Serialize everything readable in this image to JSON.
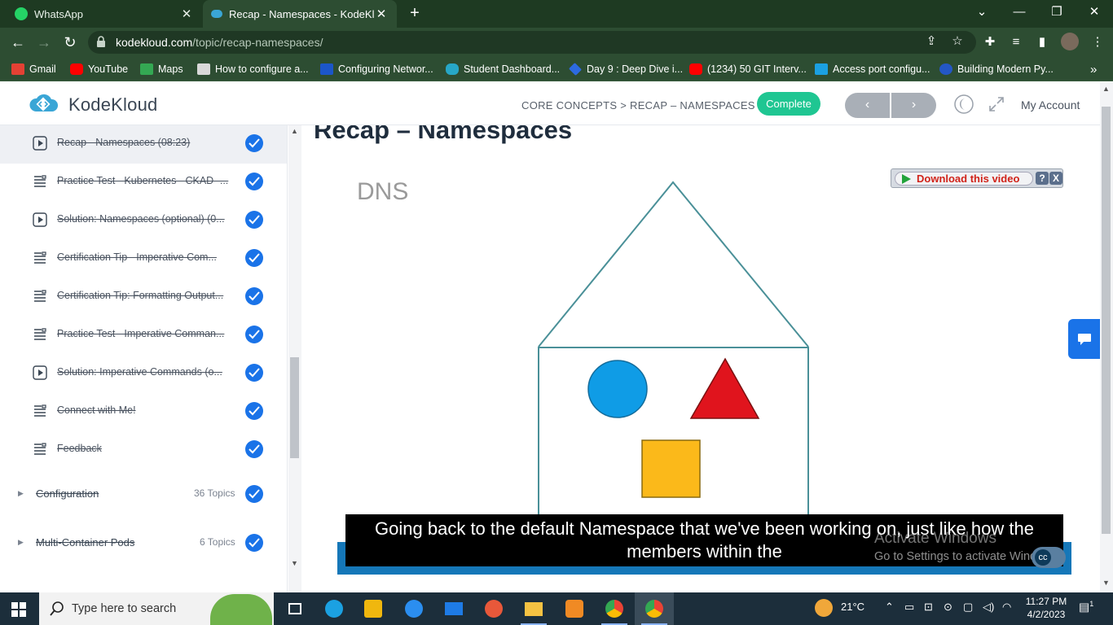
{
  "browser": {
    "tabs": [
      {
        "label": "WhatsApp",
        "close": "✕"
      },
      {
        "label": "Recap - Namespaces - KodeKloud",
        "close": "✕"
      }
    ],
    "new_tab": "+",
    "window_controls": [
      "⌄",
      "—",
      "❐",
      "✕"
    ],
    "url_domain": "kodekloud.com",
    "url_path": "/topic/recap-namespaces/",
    "bookmarks": [
      {
        "label": "Gmail",
        "color": "#e44134"
      },
      {
        "label": "YouTube",
        "color": "#ff0000"
      },
      {
        "label": "Maps",
        "color": "#34a853"
      },
      {
        "label": "How to configure a...",
        "color": "#d9d9d9"
      },
      {
        "label": "Configuring Networ...",
        "color": "#1c56c9"
      },
      {
        "label": "Student Dashboard...",
        "color": "#27a7c7"
      },
      {
        "label": "Day 9 : Deep Dive i...",
        "color": "#2d6ae0"
      },
      {
        "label": "(1234) 50 GIT Interv...",
        "color": "#ff0000"
      },
      {
        "label": "Access port configu...",
        "color": "#1ba0e2"
      },
      {
        "label": "Building Modern Py...",
        "color": "#2457c5"
      }
    ],
    "bookmarks_more": "»"
  },
  "header": {
    "brand": "KodeKloud",
    "breadcrumb": "CORE CONCEPTS > RECAP – NAMESPACES",
    "complete_label": "Complete",
    "prev_label": "‹",
    "next_label": "›",
    "account_label": "My Account"
  },
  "sidebar": {
    "lessons": [
      {
        "label": "Recap - Namespaces (08:23)",
        "type": "video",
        "current": true
      },
      {
        "label": "Practice Test - Kubernetes - CKAD -...",
        "type": "text"
      },
      {
        "label": "Solution: Namespaces (optional) (0...",
        "type": "video"
      },
      {
        "label": "Certification Tip - Imperative Com...",
        "type": "text"
      },
      {
        "label": "Certification Tip: Formatting Output...",
        "type": "text"
      },
      {
        "label": "Practice Test - Imperative Comman...",
        "type": "text"
      },
      {
        "label": "Solution: Imperative Commands (o...",
        "type": "video"
      },
      {
        "label": "Connect with Me!",
        "type": "text"
      },
      {
        "label": "Feedback",
        "type": "text"
      }
    ],
    "sections": [
      {
        "label": "Configuration",
        "count": "36 Topics"
      },
      {
        "label": "Multi-Container Pods",
        "count": "6 Topics"
      }
    ]
  },
  "content": {
    "title": "Recap – Namespaces",
    "video_label": "DNS",
    "download_label": "Download this video",
    "download_help": "?",
    "download_close": "X",
    "caption": "Going back to the default Namespace that we've been working on, just like how the members within the",
    "watermark_title": "Activate Windows",
    "watermark_sub": "Go to Settings to activate Windows."
  },
  "taskbar": {
    "search_placeholder": "Type here to search",
    "weather": "21°C",
    "time": "11:27 PM",
    "date": "4/2/2023",
    "notifications": "1"
  }
}
